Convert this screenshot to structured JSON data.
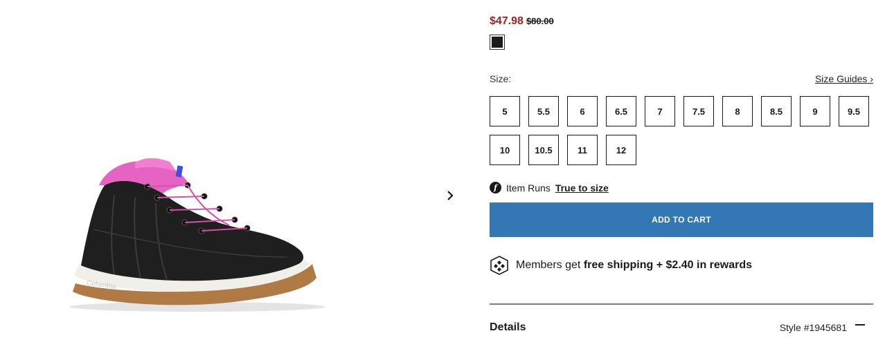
{
  "price": {
    "sale": "$47.98",
    "original": "$80.00"
  },
  "color_swatch": {
    "color": "#1b1b1b",
    "selected": true
  },
  "size": {
    "label": "Size:",
    "guides_link": "Size Guides ›",
    "options": [
      "5",
      "5.5",
      "6",
      "6.5",
      "7",
      "7.5",
      "8",
      "8.5",
      "9",
      "9.5",
      "10",
      "10.5",
      "11",
      "12"
    ]
  },
  "fit": {
    "icon_glyph": "f",
    "label": "Item Runs",
    "value": "True to size"
  },
  "cart": {
    "button_label": "ADD TO CART"
  },
  "members": {
    "prefix": "Members get",
    "highlight": "free shipping + $2.40 in rewards"
  },
  "details": {
    "title": "Details",
    "style": "Style #1945681"
  },
  "colors": {
    "sale": "#a32121",
    "cart_button": "#3378b5"
  },
  "icons": {
    "next": "chevron-right-icon",
    "members": "rewards-diamond-icon",
    "collapse": "minus-icon"
  }
}
